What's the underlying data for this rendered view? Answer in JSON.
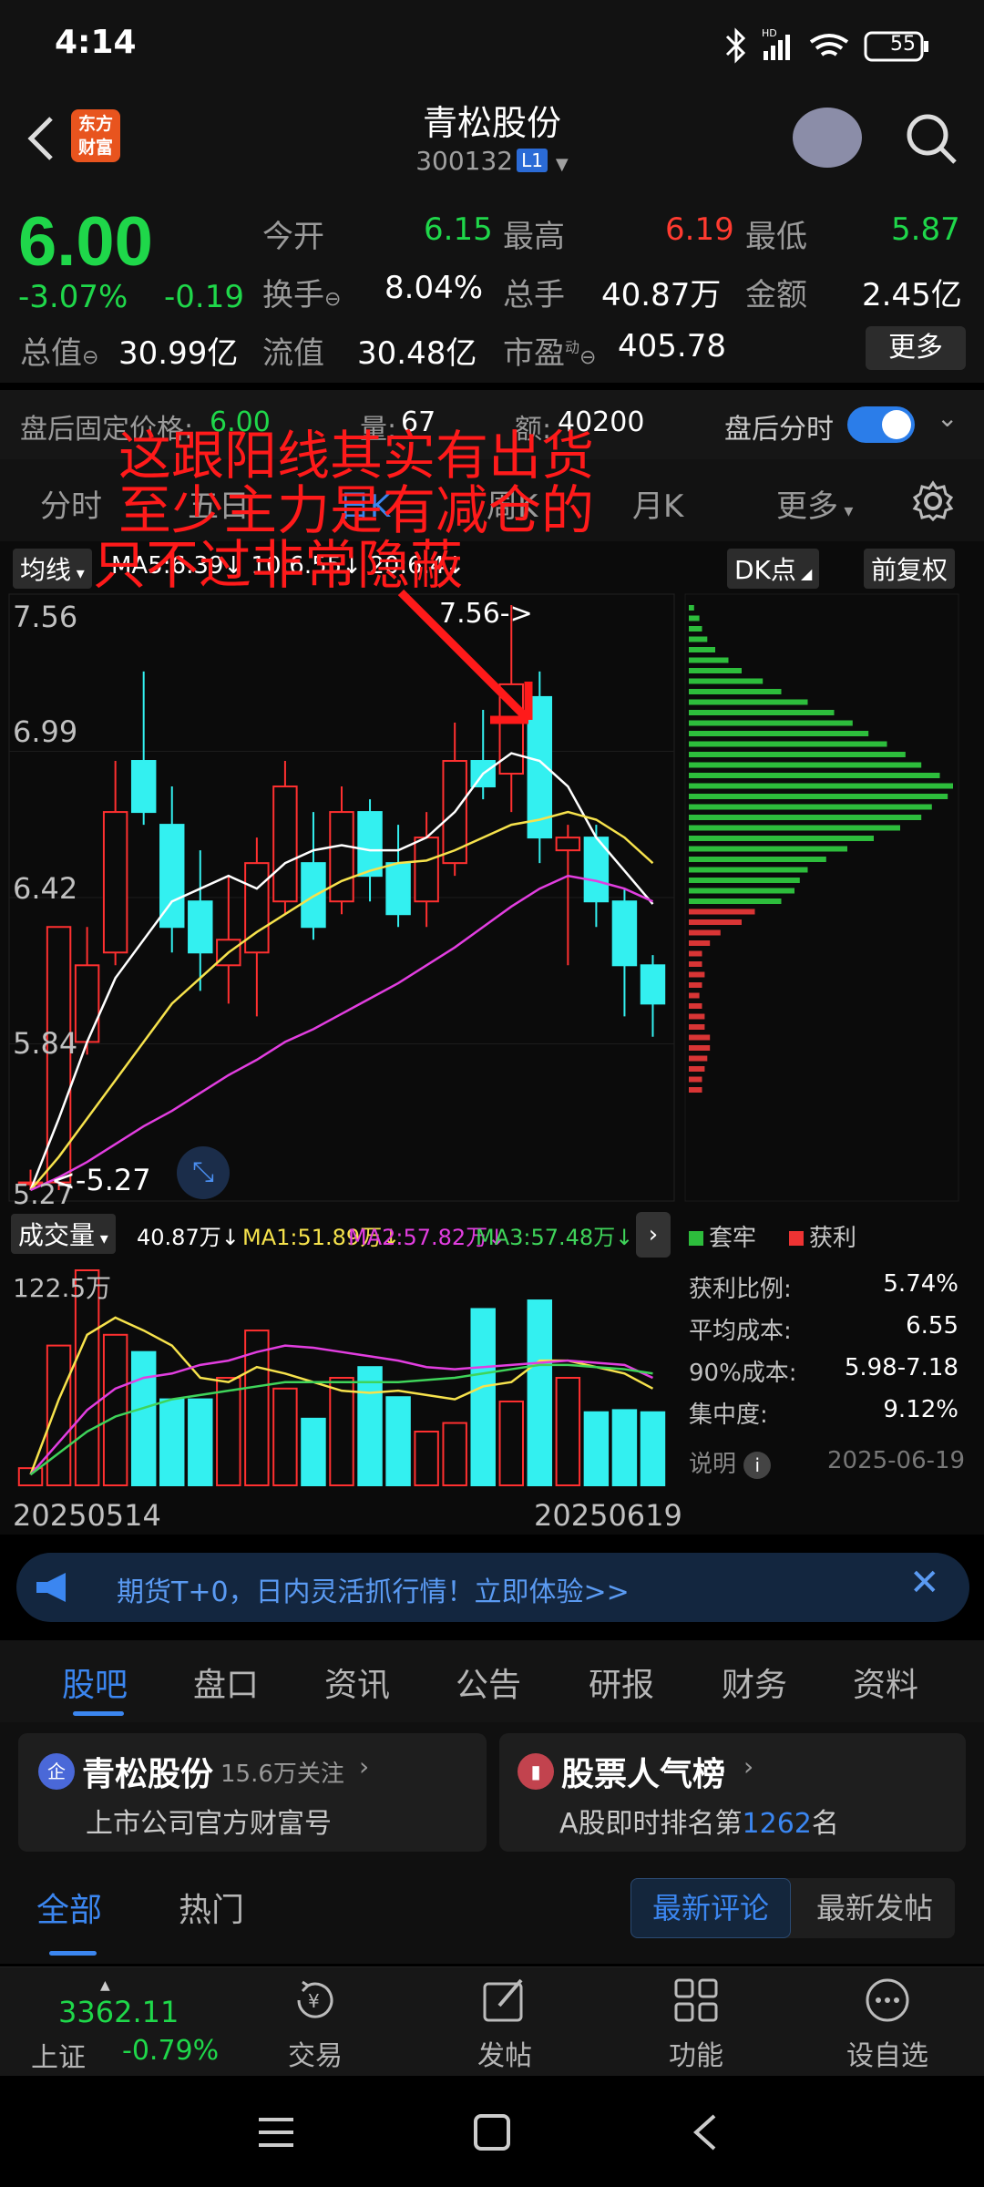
{
  "status": {
    "time": "4:14",
    "battery": "55",
    "hd": "HD"
  },
  "header": {
    "brand_logo": "东方财富",
    "title": "青松股份",
    "code": "300132",
    "level_badge": "L1"
  },
  "quote": {
    "price": "6.00",
    "change_pct": "-3.07%",
    "change": "-0.19",
    "row1": [
      {
        "label": "今开",
        "value": "6.15"
      },
      {
        "label": "最高",
        "value": "6.19"
      },
      {
        "label": "最低",
        "value": "5.87"
      }
    ],
    "row2": [
      {
        "label": "换手",
        "value": "8.04%"
      },
      {
        "label": "总手",
        "value": "40.87万"
      },
      {
        "label": "金额",
        "value": "2.45亿"
      }
    ],
    "row3": [
      {
        "label": "总值",
        "value": "30.99亿"
      },
      {
        "label": "流值",
        "value": "30.48亿"
      },
      {
        "label": "市盈",
        "value": "405.78",
        "sup": "动"
      }
    ],
    "more": "更多"
  },
  "after_hours": {
    "label": "盘后固定价格:",
    "price": "6.00",
    "vol_label": "量:",
    "vol": "67",
    "amt_label": "额:",
    "amt": "40200",
    "timeshare_label": "盘后分时"
  },
  "period_tabs": [
    "分时",
    "五日",
    "日K",
    "周K",
    "月K",
    "更多"
  ],
  "chart": {
    "ma_chip": "均线",
    "ma_text": "MA5:6.39↓ 10:6.55↓ 20:6.4↓",
    "dk_chip": "DK点",
    "adj_chip": "前复权",
    "price_ticks": [
      "7.56",
      "6.99",
      "6.42",
      "5.84",
      "5.27"
    ],
    "high_marker": "7.56->",
    "low_marker": "<-5.27",
    "vol_chip": "成交量",
    "vol_value": "40.87万↓",
    "ma1": "MA1:51.89万↓",
    "ma2": "MA2:57.82万↓",
    "ma3": "MA3:57.48万↓",
    "vol_tick": "122.5万",
    "date_start": "20250514",
    "date_end": "20250619"
  },
  "chip_panel": {
    "legend_hold": "套牢",
    "legend_profit": "获利",
    "stats": [
      {
        "label": "获利比例:",
        "value": "5.74%"
      },
      {
        "label": "平均成本:",
        "value": "6.55"
      },
      {
        "label": "90%成本:",
        "value": "5.98-7.18"
      },
      {
        "label": "集中度:",
        "value": "9.12%"
      }
    ],
    "note": "说明",
    "date": "2025-06-19"
  },
  "chart_data": {
    "type": "candlestick",
    "candles": [
      {
        "o": 5.3,
        "c": 5.3,
        "h": 5.35,
        "l": 5.27
      },
      {
        "o": 5.3,
        "c": 6.3,
        "h": 6.3,
        "l": 5.27
      },
      {
        "o": 5.85,
        "c": 6.15,
        "h": 6.3,
        "l": 5.8
      },
      {
        "o": 6.2,
        "c": 6.75,
        "h": 6.95,
        "l": 6.15
      },
      {
        "o": 6.95,
        "c": 6.75,
        "h": 7.3,
        "l": 6.7
      },
      {
        "o": 6.7,
        "c": 6.3,
        "h": 6.85,
        "l": 6.2
      },
      {
        "o": 6.4,
        "c": 6.2,
        "h": 6.6,
        "l": 6.05
      },
      {
        "o": 6.15,
        "c": 6.25,
        "h": 6.5,
        "l": 6.0
      },
      {
        "o": 6.2,
        "c": 6.55,
        "h": 6.65,
        "l": 5.95
      },
      {
        "o": 6.4,
        "c": 6.85,
        "h": 6.95,
        "l": 6.35
      },
      {
        "o": 6.55,
        "c": 6.3,
        "h": 6.75,
        "l": 6.25
      },
      {
        "o": 6.4,
        "c": 6.75,
        "h": 6.85,
        "l": 6.35
      },
      {
        "o": 6.75,
        "c": 6.5,
        "h": 6.8,
        "l": 6.4
      },
      {
        "o": 6.55,
        "c": 6.35,
        "h": 6.7,
        "l": 6.3
      },
      {
        "o": 6.4,
        "c": 6.65,
        "h": 6.75,
        "l": 6.3
      },
      {
        "o": 6.55,
        "c": 6.95,
        "h": 7.1,
        "l": 6.5
      },
      {
        "o": 6.95,
        "c": 6.85,
        "h": 7.15,
        "l": 6.8
      },
      {
        "o": 6.9,
        "c": 7.25,
        "h": 7.56,
        "l": 6.75
      },
      {
        "o": 7.2,
        "c": 6.65,
        "h": 7.3,
        "l": 6.55
      },
      {
        "o": 6.6,
        "c": 6.65,
        "h": 6.7,
        "l": 6.15
      },
      {
        "o": 6.65,
        "c": 6.4,
        "h": 6.7,
        "l": 6.3
      },
      {
        "o": 6.4,
        "c": 6.15,
        "h": 6.45,
        "l": 5.95
      },
      {
        "o": 6.15,
        "c": 6.0,
        "h": 6.19,
        "l": 5.87
      }
    ],
    "ma5": [
      5.27,
      5.55,
      5.85,
      6.1,
      6.25,
      6.4,
      6.45,
      6.5,
      6.45,
      6.55,
      6.6,
      6.62,
      6.6,
      6.6,
      6.65,
      6.75,
      6.9,
      6.98,
      6.95,
      6.85,
      6.65,
      6.52,
      6.39
    ],
    "ma10": [
      5.27,
      5.4,
      5.55,
      5.7,
      5.85,
      6.0,
      6.1,
      6.2,
      6.28,
      6.35,
      6.42,
      6.48,
      6.52,
      6.55,
      6.56,
      6.6,
      6.65,
      6.7,
      6.72,
      6.75,
      6.72,
      6.65,
      6.55
    ],
    "ma20": [
      5.27,
      5.32,
      5.38,
      5.45,
      5.52,
      5.58,
      5.65,
      5.72,
      5.78,
      5.85,
      5.9,
      5.96,
      6.02,
      6.08,
      6.15,
      6.22,
      6.3,
      6.38,
      6.45,
      6.5,
      6.48,
      6.45,
      6.4
    ],
    "volumes": [
      8,
      65,
      100,
      70,
      62,
      40,
      40,
      50,
      72,
      45,
      31,
      50,
      55,
      41,
      25,
      29,
      82,
      39,
      86,
      50,
      34,
      35,
      34
    ],
    "vol_ma1": [
      5,
      40,
      70,
      78,
      72,
      65,
      50,
      48,
      55,
      52,
      48,
      44,
      43,
      44,
      42,
      40,
      46,
      48,
      58,
      58,
      55,
      52,
      45
    ],
    "vol_ma2": [
      5,
      20,
      35,
      45,
      50,
      52,
      56,
      58,
      62,
      65,
      64,
      62,
      60,
      58,
      55,
      54,
      55,
      56,
      57,
      58,
      57,
      56,
      50
    ],
    "vol_ma3": [
      5,
      15,
      25,
      32,
      36,
      40,
      42,
      44,
      46,
      48,
      48,
      48,
      48,
      48,
      49,
      50,
      52,
      54,
      56,
      56,
      55,
      54,
      52
    ],
    "ylim": [
      5.27,
      7.56
    ],
    "chip_bars_green": [
      0.02,
      0.04,
      0.05,
      0.07,
      0.1,
      0.15,
      0.2,
      0.28,
      0.35,
      0.45,
      0.55,
      0.62,
      0.68,
      0.75,
      0.82,
      0.88,
      0.95,
      1.0,
      0.98,
      0.92,
      0.88,
      0.8,
      0.7,
      0.6,
      0.52,
      0.45,
      0.42,
      0.4,
      0.35
    ],
    "chip_bars_red": [
      0.25,
      0.2,
      0.12,
      0.08,
      0.05,
      0.05,
      0.06,
      0.05,
      0.04,
      0.05,
      0.06,
      0.06,
      0.08,
      0.08,
      0.07,
      0.06,
      0.05,
      0.05
    ]
  },
  "annotation": {
    "line1": "这跟阳线其实有出货",
    "line2": "至少主力是有减仓的",
    "line3": "只不过非常隐蔽"
  },
  "promo": {
    "text": "期货T+0，日内灵活抓行情！立即体验>>"
  },
  "main_tabs": [
    "股吧",
    "盘口",
    "资讯",
    "公告",
    "研报",
    "财务",
    "资料"
  ],
  "cards": [
    {
      "icon": "企",
      "title": "青松股份",
      "follow": "15.6万关注",
      "sub": "上市公司官方财富号"
    },
    {
      "title": "股票人气榜",
      "sub_pre": "A股即时排名第",
      "rank": "1262",
      "sub_post": "名"
    }
  ],
  "sub_tabs": {
    "all": "全部",
    "hot": "热门",
    "latest_comment": "最新评论",
    "latest_post": "最新发帖"
  },
  "bottom_nav": {
    "index_value": "3362.11",
    "index_name": "上证",
    "index_change": "-0.79%",
    "items": [
      "交易",
      "发帖",
      "功能",
      "设自选"
    ]
  }
}
